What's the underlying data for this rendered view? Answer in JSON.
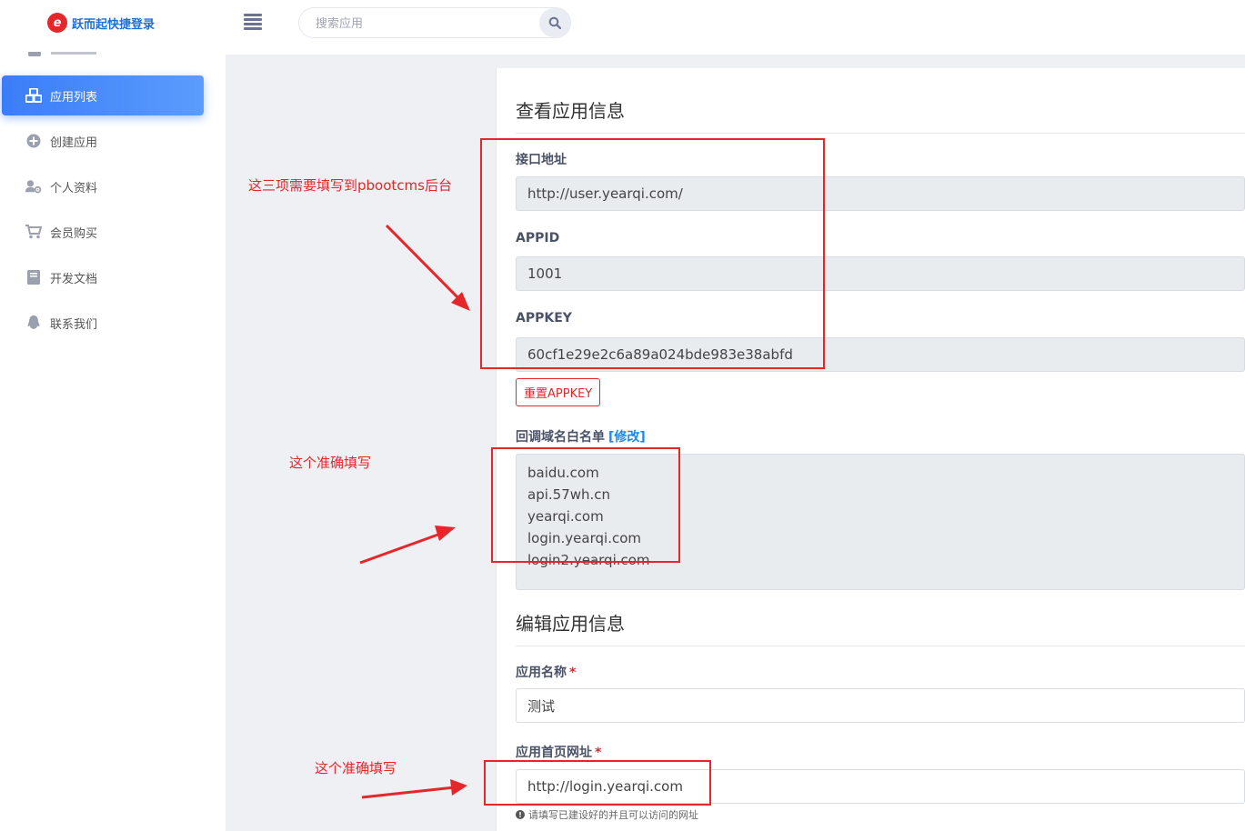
{
  "header": {
    "logo_glyph": "e",
    "app_title": "跃而起快捷登录",
    "search_placeholder": "搜索应用"
  },
  "sidebar": {
    "items": [
      {
        "label": "应用列表",
        "icon": "cubes-icon",
        "active": true
      },
      {
        "label": "创建应用",
        "icon": "plus-circle-icon",
        "active": false
      },
      {
        "label": "个人资料",
        "icon": "user-cog-icon",
        "active": false
      },
      {
        "label": "会员购买",
        "icon": "cart-icon",
        "active": false
      },
      {
        "label": "开发文档",
        "icon": "book-icon",
        "active": false
      },
      {
        "label": "联系我们",
        "icon": "qq-icon",
        "active": false
      }
    ]
  },
  "view_section": {
    "title": "查看应用信息",
    "api_url_label": "接口地址",
    "api_url_value": "http://user.yearqi.com/",
    "appid_label": "APPID",
    "appid_value": "1001",
    "appkey_label": "APPKEY",
    "appkey_value": "60cf1e29e2c6a89a024bde983e38abfd",
    "reset_button": "重置APPKEY",
    "whitelist_label": "回调域名白名单",
    "whitelist_edit": "[修改]",
    "whitelist_domains": [
      "baidu.com",
      "api.57wh.cn",
      "yearqi.com",
      "login.yearqi.com",
      "login2.yearqi.com"
    ]
  },
  "edit_section": {
    "title": "编辑应用信息",
    "name_label": "应用名称",
    "name_value": "测试",
    "homepage_label": "应用首页网址",
    "homepage_value": "http://login.yearqi.com",
    "required_mark": "*",
    "homepage_help": "请填写已建设好的并且可以访问的网址"
  },
  "annotations": {
    "note_top": "这三项需要填写到pbootcms后台",
    "note_whitelist": "这个准确填写",
    "note_homepage": "这个准确填写",
    "color": "#e5262b"
  },
  "colors": {
    "accent": "#3b7df8",
    "danger": "#e5262b",
    "link": "#1e88e5"
  }
}
